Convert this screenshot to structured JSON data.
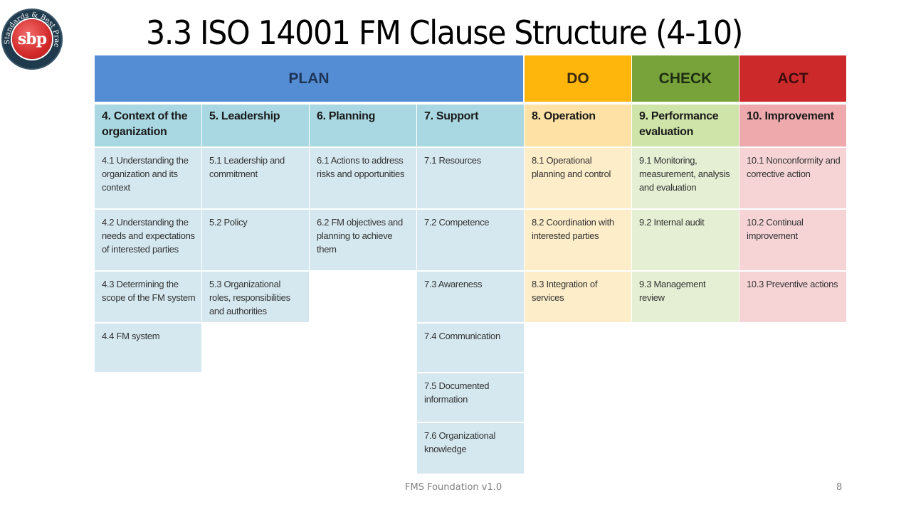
{
  "logo": {
    "text": "sbp",
    "ring_text": "Standards & Best Practice"
  },
  "title": "3.3 ISO 14001 FM Clause Structure (4-10)",
  "colors": {
    "plan": "#548dd4",
    "do": "#ffb60c",
    "check": "#77a33a",
    "act": "#cc2a2a",
    "plan_head": "#a9d8e2",
    "plan_cell": "#d5e8ef",
    "do_head": "#fde1a5",
    "do_cell": "#fdedc9",
    "check_head": "#cfe4a8",
    "check_cell": "#e4efd3",
    "act_head": "#eea9ad",
    "act_cell": "#f6d4d6"
  },
  "phases": {
    "plan": "PLAN",
    "do": "DO",
    "check": "CHECK",
    "act": "ACT"
  },
  "clauses": [
    {
      "heading": "4. Context of the organization",
      "items": [
        "4.1 Understanding the organization and its context",
        "4.2 Understanding the needs and expectations of interested parties",
        "4.3 Determining the scope of the FM system",
        "4.4 FM system"
      ]
    },
    {
      "heading": "5. Leadership",
      "items": [
        "5.1 Leadership and commitment",
        "5.2 Policy",
        "5.3 Organizational roles, responsibilities and authorities"
      ]
    },
    {
      "heading": "6. Planning",
      "items": [
        "6.1 Actions to address risks and opportunities",
        "6.2 FM objectives and planning to achieve them"
      ]
    },
    {
      "heading": "7. Support",
      "items": [
        "7.1 Resources",
        "7.2 Competence",
        "7.3 Awareness",
        "7.4 Communication",
        "7.5 Documented information",
        "7.6 Organizational knowledge"
      ]
    },
    {
      "heading": "8. Operation",
      "items": [
        "8.1 Operational planning and control",
        "8.2 Coordination with interested parties",
        "8.3 Integration of services"
      ]
    },
    {
      "heading": "9. Performance evaluation",
      "items": [
        "9.1 Monitoring, measurement, analysis and evaluation",
        "9.2 Internal audit",
        "9.3 Management review"
      ]
    },
    {
      "heading": "10. Improvement",
      "items": [
        "10.1 Nonconformity and corrective action",
        "10.2 Continual improvement",
        "10.3 Preventive actions"
      ]
    }
  ],
  "footer": {
    "text": "FMS Foundation v1.0",
    "page": "8"
  }
}
